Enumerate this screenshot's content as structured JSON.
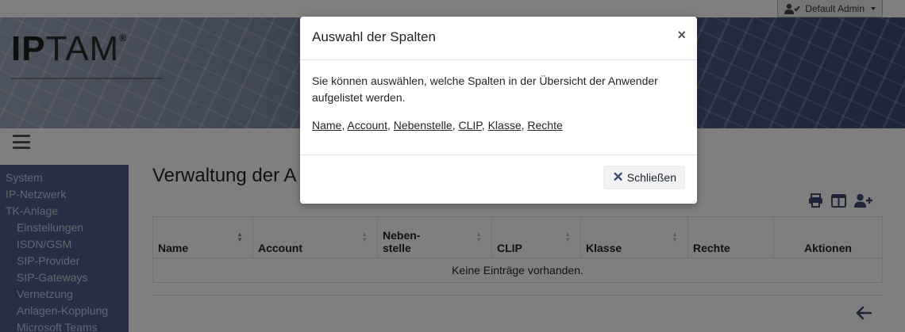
{
  "header": {
    "user_label": "Default Admin"
  },
  "brand": {
    "logo_bold": "IP",
    "logo_thin": "TAM",
    "logo_reg": "®"
  },
  "sidebar": {
    "items": [
      {
        "label": "System"
      },
      {
        "label": "IP-Netzwerk"
      },
      {
        "label": "TK-Anlage"
      },
      {
        "label": "Einstellungen"
      },
      {
        "label": "ISDN/GSM"
      },
      {
        "label": "SIP-Provider"
      },
      {
        "label": "SIP-Gateways"
      },
      {
        "label": "Vernetzung"
      },
      {
        "label": "Anlagen-Kopplung"
      },
      {
        "label": "Microsoft Teams"
      }
    ]
  },
  "main": {
    "title": "Verwaltung der A",
    "table": {
      "columns": [
        {
          "label": "Name"
        },
        {
          "label": "Account"
        },
        {
          "label_line1": "Neben-",
          "label_line2": "stelle"
        },
        {
          "label": "CLIP"
        },
        {
          "label": "Klasse"
        },
        {
          "label": "Rechte"
        },
        {
          "label": "Aktionen"
        }
      ],
      "empty_text": "Keine Einträge vorhanden."
    }
  },
  "modal": {
    "title": "Auswahl der Spalten",
    "close_symbol": "×",
    "description": "Sie können auswählen, welche Spalten in der Übersicht der Anwender aufgelistet werden.",
    "column_links": [
      "Name",
      "Account",
      "Nebenstelle",
      "CLIP",
      "Klasse",
      "Rechte"
    ],
    "separator": ", ",
    "close_button_symbol": "✕",
    "close_button_label": "Schließen"
  },
  "colors": {
    "sidebar_bg": "#4d5e8c",
    "accent": "#3d4b72"
  }
}
